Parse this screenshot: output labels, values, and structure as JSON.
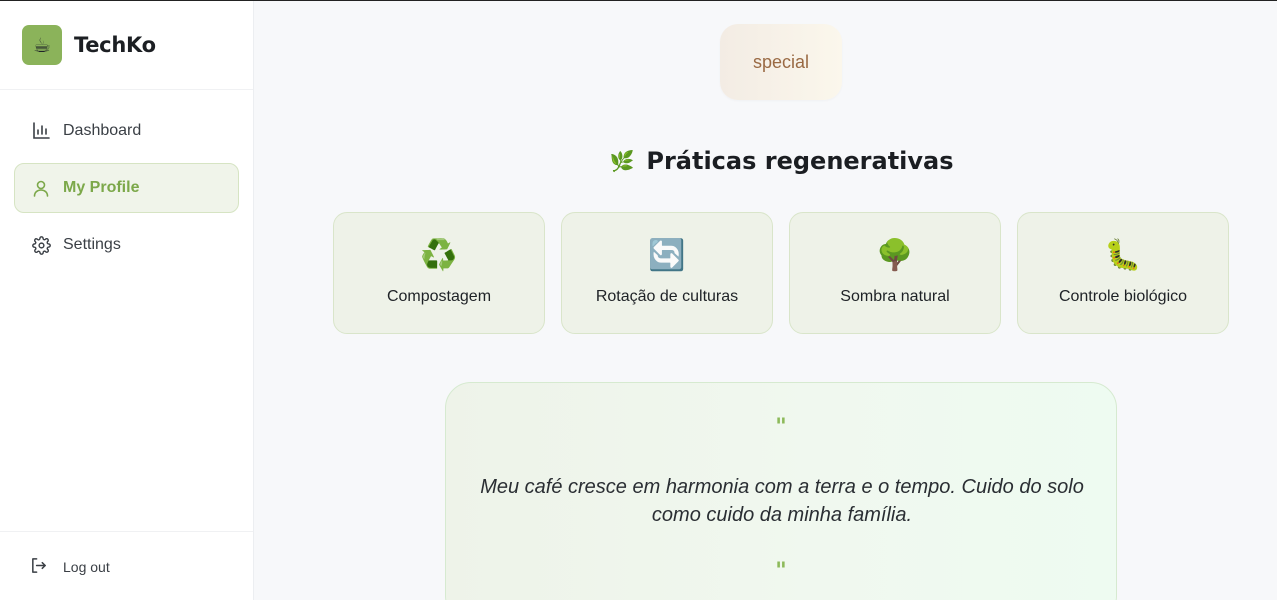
{
  "brand": {
    "name": "TechKo",
    "logo_icon": "☕"
  },
  "sidebar": {
    "items": [
      {
        "label": "Dashboard",
        "icon": "bar-chart-icon",
        "active": false
      },
      {
        "label": "My Profile",
        "icon": "user-icon",
        "active": true
      },
      {
        "label": "Settings",
        "icon": "gear-icon",
        "active": false
      }
    ],
    "logout_label": "Log out"
  },
  "badge": {
    "label": "special"
  },
  "section": {
    "icon": "🌿",
    "title": "Práticas regenerativas"
  },
  "practices": [
    {
      "emoji": "♻️",
      "label": "Compostagem"
    },
    {
      "emoji": "🔄",
      "label": "Rotação de culturas"
    },
    {
      "emoji": "🌳",
      "label": "Sombra natural"
    },
    {
      "emoji": "🐛",
      "label": "Controle biológico"
    }
  ],
  "quote": {
    "open_mark": "\"",
    "text": "Meu café cresce em harmonia com a terra e o tempo. Cuido do solo como cuido da minha família.",
    "close_mark": "\""
  },
  "colors": {
    "accent": "#7ca84a",
    "brand_logo_bg": "#8bb35a",
    "badge_text": "#9a6a44"
  }
}
